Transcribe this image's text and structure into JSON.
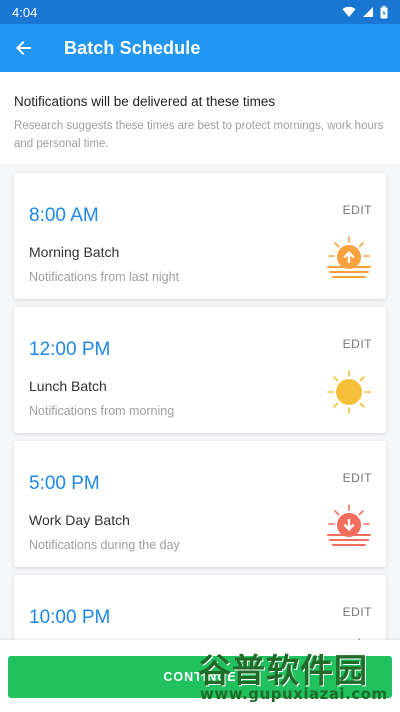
{
  "status_bar": {
    "time": "4:04"
  },
  "app_bar": {
    "title": "Batch Schedule"
  },
  "intro": {
    "title": "Notifications will be delivered at these times",
    "subtitle": "Research suggests these times are best to protect mornings, work hours and personal time."
  },
  "batches": [
    {
      "time": "8:00 AM",
      "name": "Morning Batch",
      "description": "Notifications from last night",
      "edit": "EDIT",
      "icon": "sunrise-icon"
    },
    {
      "time": "12:00 PM",
      "name": "Lunch Batch",
      "description": "Notifications from morning",
      "edit": "EDIT",
      "icon": "sun-icon"
    },
    {
      "time": "5:00 PM",
      "name": "Work Day Batch",
      "description": "Notifications during the day",
      "edit": "EDIT",
      "icon": "sunset-icon"
    },
    {
      "time": "10:00 PM",
      "name": "",
      "description": "",
      "edit": "EDIT",
      "icon": "moon-icon"
    }
  ],
  "continue_button": {
    "label": "CONTINUE"
  },
  "watermark": {
    "main": "谷普软件园",
    "sub": "www.gupuxiazai.com"
  },
  "colors": {
    "primary": "#2196F3",
    "status": "#1976D2",
    "accent": "#1E88E5",
    "button": "#21C160",
    "sunrise": "#F9A03F",
    "sun": "#F6C03A",
    "sunset": "#F26D5B"
  }
}
